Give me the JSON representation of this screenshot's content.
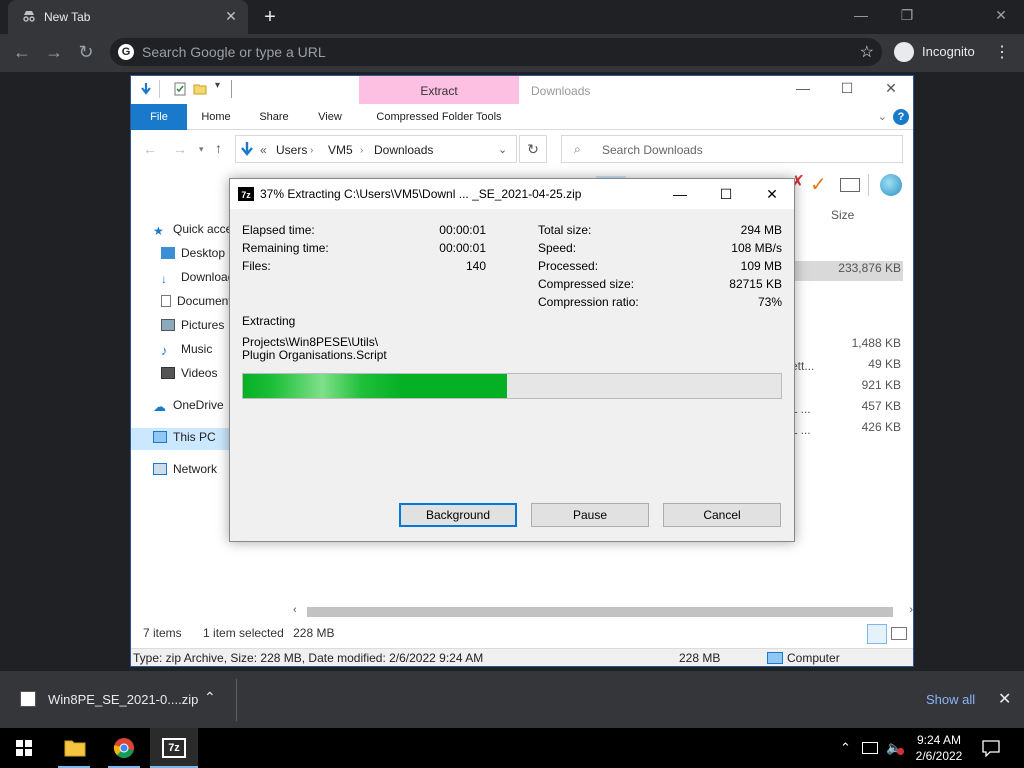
{
  "browser": {
    "tab_title": "New Tab",
    "tab_close": "✕",
    "new_tab": "+",
    "omnibox_placeholder": "Search Google or type a URL",
    "profile_label": "Incognito",
    "window_controls": [
      "—",
      "❐",
      "✕"
    ]
  },
  "explorer": {
    "contextual_tab": "Extract",
    "title": "Downloads",
    "ribbon_tabs": [
      "File",
      "Home",
      "Share",
      "View",
      "Compressed Folder Tools"
    ],
    "breadcrumb": [
      "Users",
      "VM5",
      "Downloads"
    ],
    "breadcrumb_prefix": "«",
    "search_placeholder": "Search Downloads",
    "nav_items": [
      "Quick access",
      "Desktop",
      "Downloads",
      "Documents",
      "Pictures",
      "Music",
      "Videos",
      "OneDrive",
      "This PC",
      "Network"
    ],
    "size_header": "Size",
    "file_sizes": [
      "233,876 KB",
      "1,488 KB",
      "49 KB",
      "921 KB",
      "457 KB",
      "426 KB"
    ],
    "name_fragments": [
      "ett...",
      "L ...",
      "L ..."
    ],
    "status_items": "7 items",
    "status_selected": "1 item selected",
    "status_size": "228 MB",
    "details_text": "Type: zip Archive, Size: 228 MB, Date modified: 2/6/2022 9:24 AM",
    "details_size": "228 MB",
    "details_location": "Computer"
  },
  "dialog": {
    "logo": "7z",
    "title": "37% Extracting C:\\Users\\VM5\\Downl ... _SE_2021-04-25.zip",
    "progress": 0.49,
    "left_stats": [
      {
        "label": "Elapsed time:",
        "value": "00:00:01"
      },
      {
        "label": "Remaining time:",
        "value": "00:00:01"
      },
      {
        "label": "Files:",
        "value": "140"
      }
    ],
    "right_stats": [
      {
        "label": "Total size:",
        "value": "294 MB"
      },
      {
        "label": "Speed:",
        "value": "108 MB/s"
      },
      {
        "label": "Processed:",
        "value": "109 MB"
      },
      {
        "label": "Compressed size:",
        "value": "82715 KB"
      },
      {
        "label": "Compression ratio:",
        "value": "73%"
      }
    ],
    "status_label": "Extracting",
    "current_path_line1": "Projects\\Win8PESE\\Utils\\",
    "current_path_line2": "Plugin Organisations.Script",
    "buttons": {
      "background": "Background",
      "pause": "Pause",
      "cancel": "Cancel"
    }
  },
  "download_shelf": {
    "filename": "Win8PE_SE_2021-0....zip",
    "show_all": "Show all"
  },
  "taskbar": {
    "time": "9:24 AM",
    "date": "2/6/2022"
  },
  "colors": {
    "progress_green": "#06b025",
    "ribbon_blue": "#1979ca",
    "extract_pink": "#fdbfe2",
    "link_blue": "#8ab4f8"
  }
}
